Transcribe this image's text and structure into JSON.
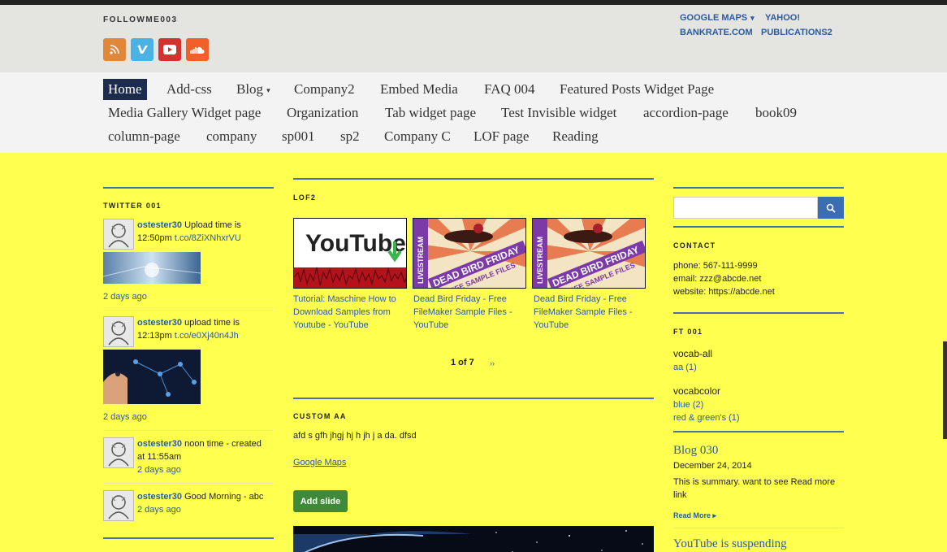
{
  "header": {
    "site_name": "FOLLOWME003",
    "social": [
      {
        "icon": "rss-icon",
        "color": "#e0873a"
      },
      {
        "icon": "vimeo-icon",
        "color": "#4ab3e6"
      },
      {
        "icon": "youtube-icon",
        "color": "#d4322e"
      },
      {
        "icon": "soundcloud-icon",
        "color": "#f06028"
      }
    ],
    "links": {
      "google_maps": "GOOGLE MAPS",
      "yahoo": "YAHOO!",
      "bankrate": "BANKRATE.COM",
      "publications": "PUBLICATIONS2"
    }
  },
  "nav": {
    "items": [
      "Home",
      "Add-css",
      "Blog",
      "Company2",
      "Embed Media",
      "FAQ 004",
      "Featured Posts Widget Page",
      "Media Gallery Widget page",
      "Organization",
      "Tab widget page",
      "Test Invisible widget",
      "accordion-page",
      "book09",
      "column-page",
      "company",
      "sp001",
      "sp2",
      "Company C",
      "LOF page",
      "Reading"
    ]
  },
  "twitter": {
    "title": "TWITTER 001",
    "tweets": [
      {
        "user": "ostester30",
        "text": " Upload time is 12:50pm ",
        "link": "t.co/8ZiXNhxrVU",
        "ago": "2 days ago"
      },
      {
        "user": "ostester30",
        "text": " upload time is 12:13pm ",
        "link": "t.co/e0Xj40n4Jh",
        "ago": "2 days ago"
      },
      {
        "user": "ostester30",
        "text": " noon time - created at 11:55am",
        "link": "",
        "ago": "2 days ago"
      },
      {
        "user": "ostester30",
        "text": " Good Morning - abc",
        "link": "",
        "ago": "2 days ago"
      }
    ]
  },
  "lof": {
    "title": "LOF2",
    "items": [
      {
        "caption": "Tutorial: Maschine How to Download Samples from Youtube - YouTube"
      },
      {
        "caption": "Dead Bird Friday - Free FileMaker Sample Files - YouTube"
      },
      {
        "caption": "Dead Bird Friday - Free FileMaker Sample Files - YouTube"
      }
    ],
    "thumb_text": {
      "youtube": "YouTube",
      "livestream": "LIVESTREAM",
      "dead_bird": "DEAD BIRD FRIDAY",
      "free_samples": "FREE SAMPLE FILES"
    },
    "pager": "1 of 7",
    "next": "››"
  },
  "custom": {
    "title": "CUSTOM AA",
    "text": "afd s gfh jhgj hj h jh j a da. dfsd",
    "link": "Google Maps",
    "button": "Add slide"
  },
  "sidebar": {
    "search_placeholder": "",
    "contact": {
      "title": "CONTACT",
      "phone": "phone: 567-111-9999",
      "email": "email: zzz@abcde.net",
      "website": "website: https://abcde.net"
    },
    "ft": {
      "title": "FT 001",
      "vocab_all": "vocab-all",
      "aa": "aa (1)",
      "vocabcolor": "vocabcolor",
      "blue": "blue (2)",
      "red_green": "red & green's (1)"
    },
    "blog": {
      "title": "Blog 030",
      "date": "December 24, 2014",
      "summary": "This is summary. want to see Read more link",
      "read_more": "Read More ▸"
    },
    "next_title": "YouTube is suspending"
  }
}
